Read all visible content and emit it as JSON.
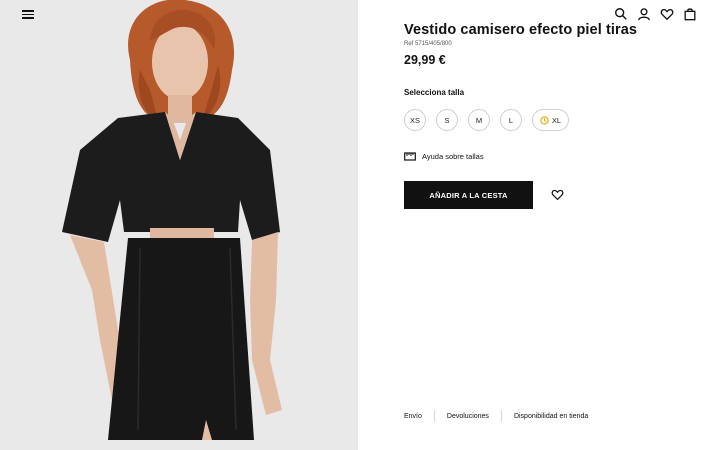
{
  "header": {
    "menu_icon": "hamburger-menu-icon",
    "icons": [
      "search-icon",
      "user-icon",
      "heart-icon",
      "bag-icon"
    ]
  },
  "product": {
    "title": "Vestido camisero efecto piel tiras",
    "ref": "Ref 5715/405/800",
    "price": "29,99 €"
  },
  "sizes": {
    "label": "Selecciona talla",
    "options": [
      "XS",
      "S",
      "M",
      "L",
      "XL"
    ]
  },
  "size_guide": {
    "label": "Ayuda sobre tallas",
    "icon": "ruler-icon"
  },
  "add_to_cart": {
    "label": "AÑADIR A LA CESTA"
  },
  "wishlist_icon": "heart-outline-icon",
  "footer": {
    "links": [
      "Envío",
      "Devoluciones",
      "Disponibilidad en tienda"
    ]
  },
  "colors": {
    "accent": "#111111",
    "photo_bg": "#e9e9ea",
    "size_border": "#cfcfcf"
  }
}
